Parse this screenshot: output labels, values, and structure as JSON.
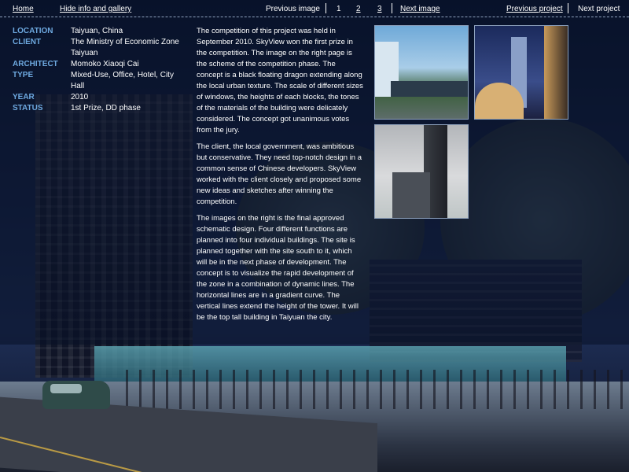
{
  "nav": {
    "home": "Home",
    "hide": "Hide info and gallery",
    "previous_image": "Previous image",
    "page_1": "1",
    "page_2": "2",
    "page_3": "3",
    "next_image": "Next image",
    "previous_project": "Previous project",
    "next_project": "Next project"
  },
  "info": {
    "location_label": "LOCATION",
    "location_value": "Taiyuan, China",
    "client_label": "CLIENT",
    "client_value": "The Ministry of Economic Zone Taiyuan",
    "architect_label": "ARCHITECT",
    "architect_value": "Momoko Xiaoqi Cai",
    "type_label": "TYPE",
    "type_value": "Mixed-Use, Office, Hotel, City Hall",
    "year_label": "YEAR",
    "year_value": "2010",
    "status_label": "STATUS",
    "status_value": "1st Prize, DD phase"
  },
  "description": {
    "p1": "The competition of this project was held in September 2010. SkyView won the first prize in the competition. The image on the right page is the scheme of the competition phase. The concept is a black floating dragon extending along the local urban texture. The scale of different sizes of windows, the heights of each blocks, the tones of the materials of the building were delicately considered. The concept got unanimous votes from the jury.",
    "p2": "The client, the local government, was ambitious but conservative. They need top-notch design in a common sense of Chinese developers. SkyView worked with the client closely and proposed some new ideas and sketches after winning the competition.",
    "p3": "The images on the right is the final approved schematic design. Four different functions are planned into four individual buildings. The site is planned together with the site south to it, which will be in the next phase of development. The concept is to visualize the rapid development of the zone in a combination of dynamic lines. The horizontal lines are in a gradient curve. The vertical lines extend the height of the tower. It will be the top tall building in Taiyuan the city."
  },
  "colors": {
    "label_blue": "#6ea9e0",
    "overlay": "#081026"
  }
}
